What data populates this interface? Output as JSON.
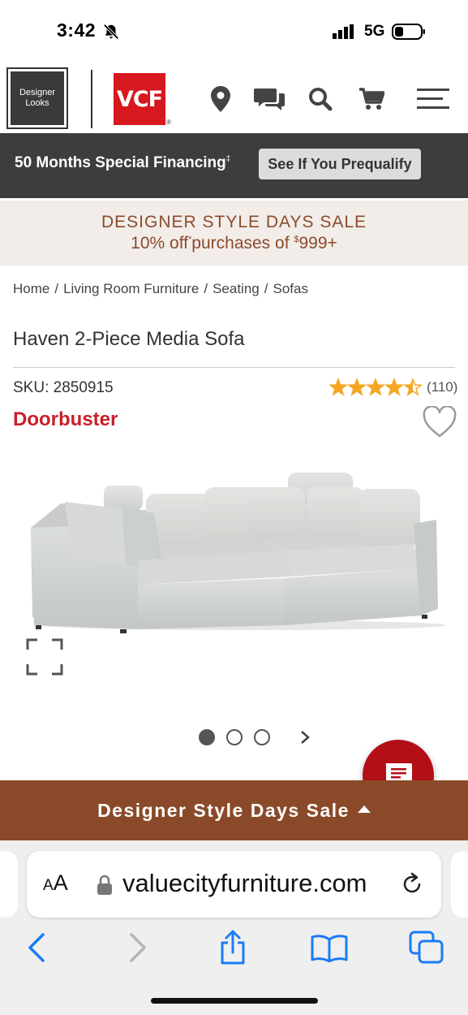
{
  "status": {
    "time": "3:42",
    "network": "5G"
  },
  "header": {
    "designer_logo_line1": "Designer",
    "designer_logo_line2": "Looks",
    "vcf_logo": "VCF",
    "icons": [
      "location-pin-icon",
      "chat-icon",
      "search-icon",
      "cart-icon",
      "menu-icon"
    ]
  },
  "financing": {
    "text": "50 Months Special Financing",
    "mark": "‡",
    "button": "See If You Prequalify"
  },
  "promo": {
    "line1": "DESIGNER STYLE DAYS SALE",
    "line2_prefix": "10% off",
    "line2_mark": "*",
    "line2_middle": "purchases of ",
    "line2_currency": "$",
    "line2_amount": "999+"
  },
  "breadcrumb": [
    "Home",
    "Living Room Furniture",
    "Seating",
    "Sofas"
  ],
  "breadcrumb_separator": "/",
  "product": {
    "title": "Haven 2-Piece Media Sofa",
    "sku": "SKU: 2850915",
    "rating": 4.5,
    "review_count": "(110)",
    "badge": "Doorbuster"
  },
  "gallery": {
    "dot_count": 3,
    "active_index": 0
  },
  "sale_drawer": {
    "label": "Designer Style Days Sale"
  },
  "browser": {
    "aa_label_small": "A",
    "aa_label_large": "A",
    "url": "valuecityfurniture.com"
  },
  "colors": {
    "brand_red": "#d8181f",
    "doorbuster_red": "#c8202a",
    "promo_brown": "#8b4a2b",
    "drawer_brown": "#8a4a29",
    "financing_bg": "#3d3d3d",
    "ios_blue": "#1a7cf5",
    "star": "#f5a623"
  }
}
